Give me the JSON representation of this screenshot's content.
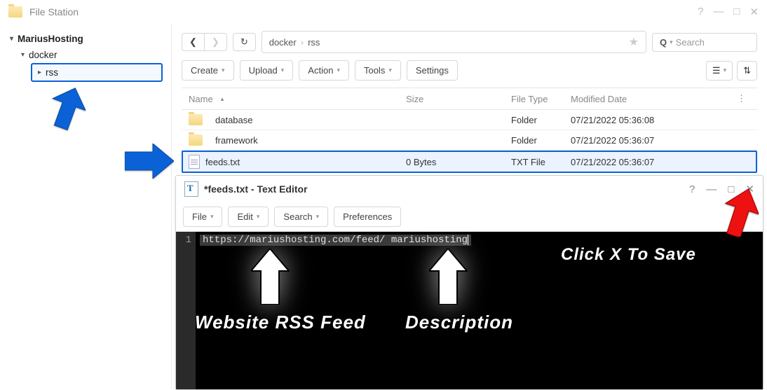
{
  "app_title": "File Station",
  "tree": {
    "root": "MariusHosting",
    "lvl1": "docker",
    "lvl2": "rss"
  },
  "breadcrumb": {
    "seg1": "docker",
    "seg2": "rss"
  },
  "search_placeholder": "Search",
  "toolbar": {
    "create": "Create",
    "upload": "Upload",
    "action": "Action",
    "tools": "Tools",
    "settings": "Settings"
  },
  "columns": {
    "name": "Name",
    "size": "Size",
    "type": "File Type",
    "date": "Modified Date"
  },
  "rows": [
    {
      "name": "database",
      "size": "",
      "type": "Folder",
      "date": "07/21/2022 05:36:08",
      "kind": "folder"
    },
    {
      "name": "framework",
      "size": "",
      "type": "Folder",
      "date": "07/21/2022 05:36:07",
      "kind": "folder"
    },
    {
      "name": "feeds.txt",
      "size": "0 Bytes",
      "type": "TXT File",
      "date": "07/21/2022 05:36:07",
      "kind": "file"
    }
  ],
  "editor": {
    "title": "*feeds.txt - Text Editor",
    "menu": {
      "file": "File",
      "edit": "Edit",
      "search": "Search",
      "prefs": "Preferences"
    },
    "line_no": "1",
    "code_url": "https://mariushosting.com/feed/",
    "code_desc": " mariushosting"
  },
  "annotations": {
    "click_x": "Click X To Save",
    "rss": "Website RSS Feed",
    "desc": "Description"
  }
}
